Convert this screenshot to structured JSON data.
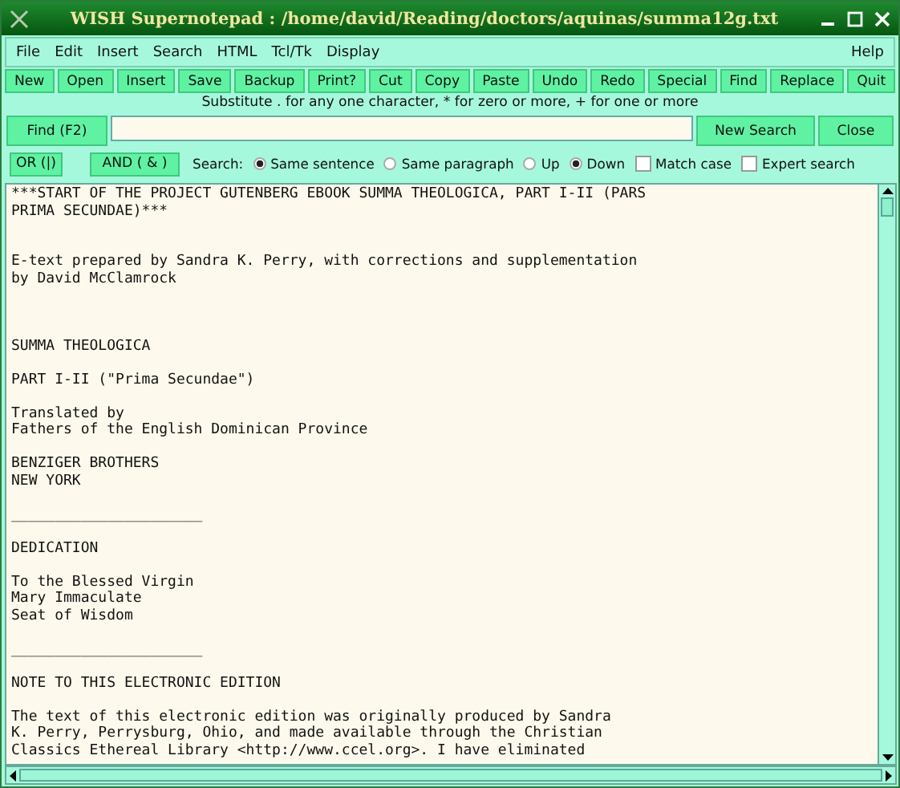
{
  "window": {
    "title": "WISH Supernotepad : /home/david/Reading/doctors/aquinas/summa12g.txt"
  },
  "menu": {
    "items": [
      "File",
      "Edit",
      "Insert",
      "Search",
      "HTML",
      "Tcl/Tk",
      "Display"
    ],
    "help": "Help"
  },
  "toolbar": [
    "New",
    "Open",
    "Insert",
    "Save",
    "Backup",
    "Print?",
    "Cut",
    "Copy",
    "Paste",
    "Undo",
    "Redo",
    "Special",
    "Find",
    "Replace",
    "Quit"
  ],
  "hint": "Substitute . for any one character, * for zero or more, + for one or more",
  "find": {
    "button": "Find (F2)",
    "new_search": "New Search",
    "close": "Close"
  },
  "search": {
    "or": "OR (|)",
    "and": "AND ( & )",
    "label": "Search:",
    "radios": [
      {
        "label": "Same sentence",
        "selected": true
      },
      {
        "label": "Same paragraph",
        "selected": false
      },
      {
        "label": "Up",
        "selected": false
      },
      {
        "label": "Down",
        "selected": true
      }
    ],
    "checks": [
      {
        "label": "Match case",
        "checked": false
      },
      {
        "label": "Expert search",
        "checked": false
      }
    ]
  },
  "document": {
    "paragraphs": [
      [
        "***START OF THE PROJECT GUTENBERG EBOOK SUMMA THEOLOGICA, PART I-II (PARS",
        "PRIMA SECUNDAE)***"
      ],
      [
        "E-text prepared by Sandra K. Perry, with corrections and supplementation",
        "by David McClamrock"
      ],
      [
        "SUMMA THEOLOGICA"
      ],
      [
        "PART I-II (\"Prima Secundae\")"
      ],
      [
        "Translated by",
        "Fathers of the English Dominican Province"
      ],
      [
        "BENZIGER BROTHERS",
        "NEW YORK"
      ],
      [
        "______________________"
      ],
      [
        "DEDICATION"
      ],
      [
        "To the Blessed Virgin",
        "Mary Immaculate",
        "Seat of Wisdom"
      ],
      [
        "______________________"
      ],
      [
        "NOTE TO THIS ELECTRONIC EDITION"
      ],
      [
        "The text of this electronic edition was originally produced by Sandra",
        "K. Perry, Perrysburg, Ohio, and made available through the Christian",
        "Classics Ethereal Library <http://www.ccel.org>. I have eliminated"
      ]
    ]
  }
}
